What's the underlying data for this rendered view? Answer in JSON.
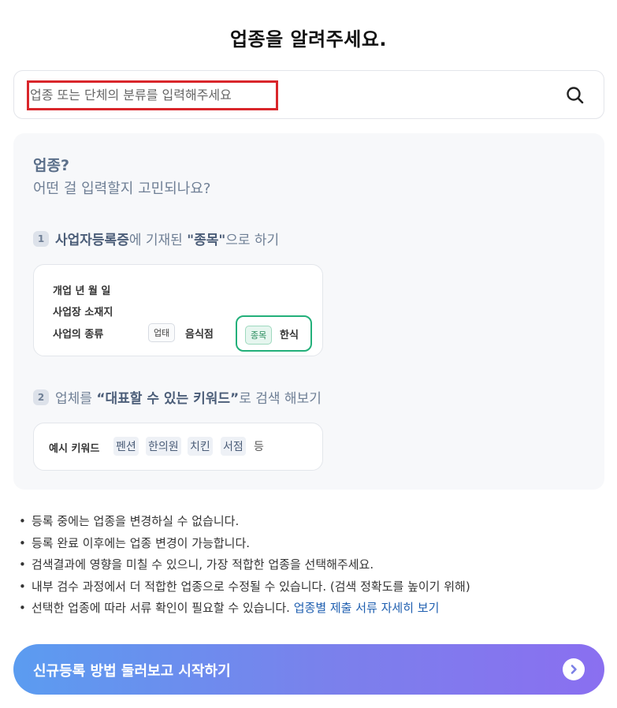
{
  "header": {
    "title": "업종을 알려주세요."
  },
  "search": {
    "placeholder": "업종 또는 단체의 분류를 입력해주세요",
    "value": ""
  },
  "guide": {
    "title": "업종?",
    "subtitle": "어떤 걸 입력할지 고민되나요?",
    "step1": {
      "number": "1",
      "bold1": "사업자등록증",
      "text1": "에 기재된 ",
      "bold2": "\"종목\"",
      "text2": "으로 하기"
    },
    "card1": {
      "row1": "개업 년 월 일",
      "row2": "사업장 소재지",
      "row3": "사업의 종류",
      "tag_type": "업태",
      "value_type": "음식점",
      "tag_item": "종목",
      "value_item": "한식"
    },
    "step2": {
      "number": "2",
      "text1": "업체를 ",
      "bold": "“대표할 수 있는 키워드”",
      "text2": "로 검색 해보기"
    },
    "card2": {
      "label": "예시 키워드",
      "keywords": [
        "펜션",
        "한의원",
        "치킨",
        "서점"
      ],
      "etc": "등"
    }
  },
  "notes": [
    "등록 중에는 업종을 변경하실 수 없습니다.",
    "등록 완료 이후에는 업종 변경이 가능합니다.",
    "검색결과에 영향을 미칠 수 있으니, 가장 적합한 업종을 선택해주세요.",
    "내부 검수 과정에서 더 적합한 업종으로 수정될 수 있습니다. (검색 정확도를 높이기 위해)",
    "선택한 업종에 따라 서류 확인이 필요할 수 있습니다. "
  ],
  "notes_link": "업종별 제출 서류 자세히 보기",
  "cta": {
    "label": "신규등록 방법 둘러보고 시작하기"
  },
  "colors": {
    "highlight": "#d9262b",
    "accent_green": "#23b07a",
    "link": "#1f5fb0",
    "cta_start": "#5b9cf0",
    "cta_end": "#8a6ff0"
  },
  "icons": {
    "search": "search-icon",
    "cta": "chevron-right-icon"
  }
}
